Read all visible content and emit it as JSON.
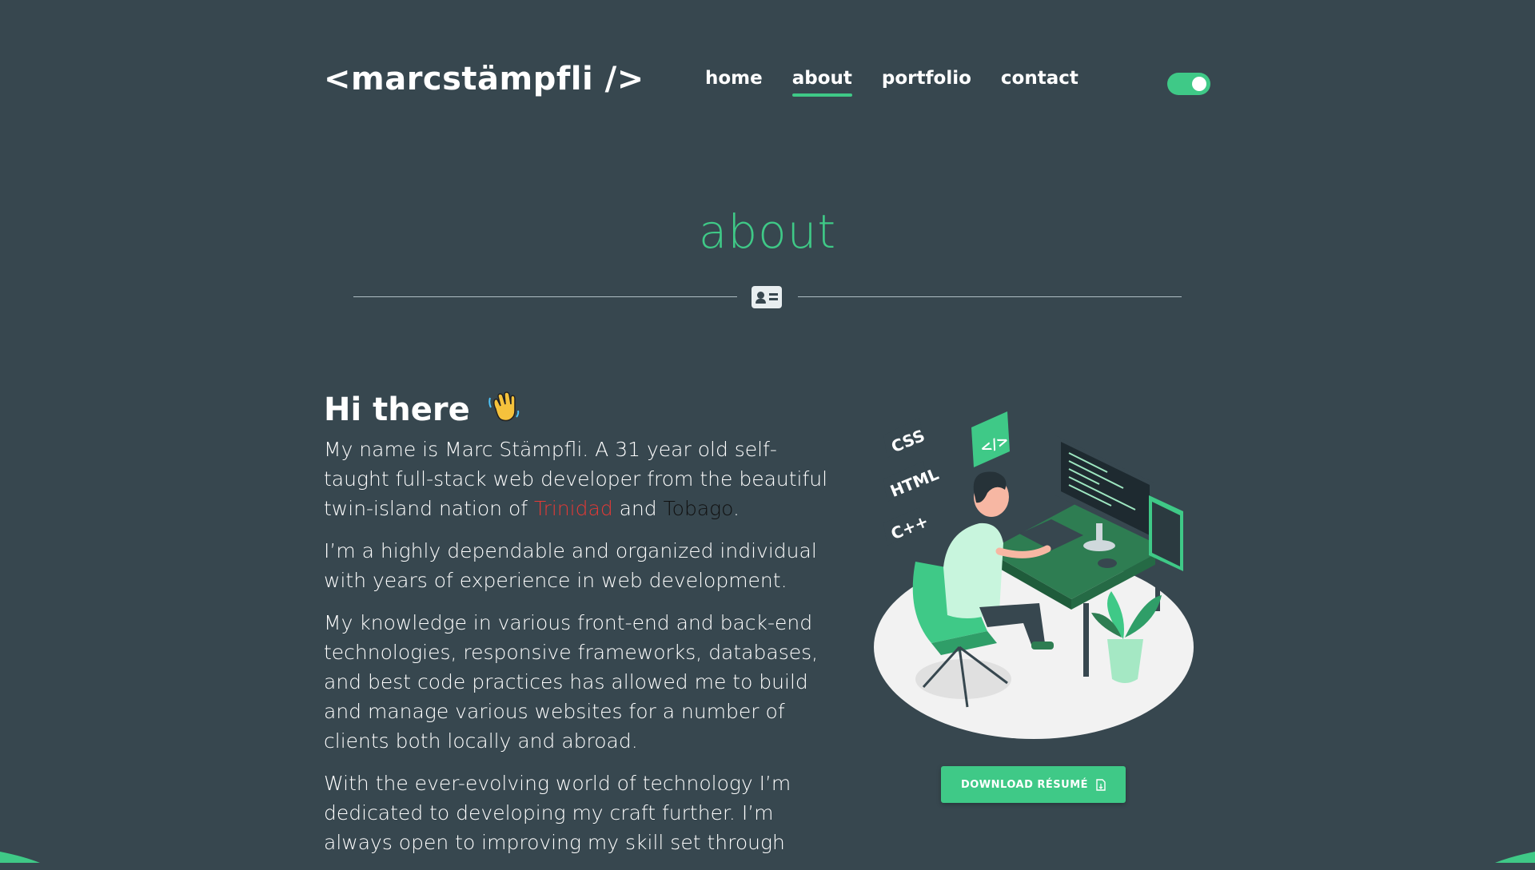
{
  "header": {
    "logo": "<marcstämpfli />",
    "nav": [
      {
        "label": "home",
        "active": false
      },
      {
        "label": "about",
        "active": true
      },
      {
        "label": "portfolio",
        "active": false
      },
      {
        "label": "contact",
        "active": false
      }
    ],
    "theme_toggle": {
      "on": true,
      "color": "#3fc987"
    }
  },
  "section": {
    "title": "about",
    "divider_icon": "id-card-icon"
  },
  "intro": {
    "greeting": "Hi there",
    "greeting_emoji": "waving-hand-icon",
    "p1_before": "My name is Marc Stämpfli. A 31 year old self-taught full-stack web developer from the beautiful twin-island nation of ",
    "p1_trinidad": "Trinidad",
    "p1_and": " and ",
    "p1_tobago": "Tobago",
    "p1_end": ".",
    "p2": "I’m a highly dependable and organized individual with years of experience in web development.",
    "p3": "My knowledge in various front-end and back-end technologies, responsive frameworks, databases, and best code practices has allowed me to build and manage various websites for a number of clients both locally and abroad.",
    "p4": "With the ever-evolving world of technology I’m dedicated to developing my craft further. I’m always open to improving my skill set through"
  },
  "illustration": {
    "labels": [
      "CSS",
      "HTML",
      "C++"
    ],
    "code_badge": "</>"
  },
  "download_button": {
    "label": "DOWNLOAD RÉSUMÉ",
    "icon": "file-icon"
  },
  "colors": {
    "background": "#37474f",
    "accent": "#3fc987",
    "trinidad": "#e53935",
    "tobago": "#111111"
  }
}
